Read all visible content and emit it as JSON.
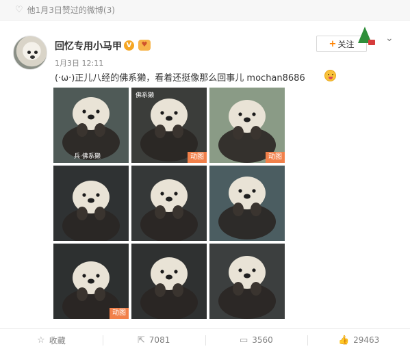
{
  "notice": {
    "text": "他1月3日赞过的微博(3)",
    "icon": "heart-icon"
  },
  "post": {
    "author": "回忆专用小马甲",
    "verified_badge": "V",
    "member_badge": "heart-badge-icon",
    "time": "1月3日 12:11",
    "text": "(·ω·)正儿八经的佛系獭，看着还挺像那么回事儿 mochan8686",
    "emoji": "yummy-emoji-icon",
    "follow_label": "关注",
    "images": [
      {
        "caption": "兵·佛系獭",
        "tag": "",
        "bg": "#4f5a57"
      },
      {
        "caption": "佛系獭",
        "tag": "动图",
        "bg": "#3b3d3a"
      },
      {
        "caption": "",
        "tag": "动图",
        "bg": "#8a9b86"
      },
      {
        "caption": "",
        "tag": "",
        "bg": "#2f3233"
      },
      {
        "caption": "",
        "tag": "",
        "bg": "#353838"
      },
      {
        "caption": "",
        "tag": "",
        "bg": "#4b5d61"
      },
      {
        "caption": "",
        "tag": "动图",
        "bg": "#2d3030"
      },
      {
        "caption": "",
        "tag": "",
        "bg": "#2f3131"
      },
      {
        "caption": "",
        "tag": "",
        "bg": "#3c3f3f"
      }
    ]
  },
  "actions": {
    "favorite_label": "收藏",
    "repost_count": "7081",
    "comment_count": "3560",
    "like_count": "29463"
  }
}
